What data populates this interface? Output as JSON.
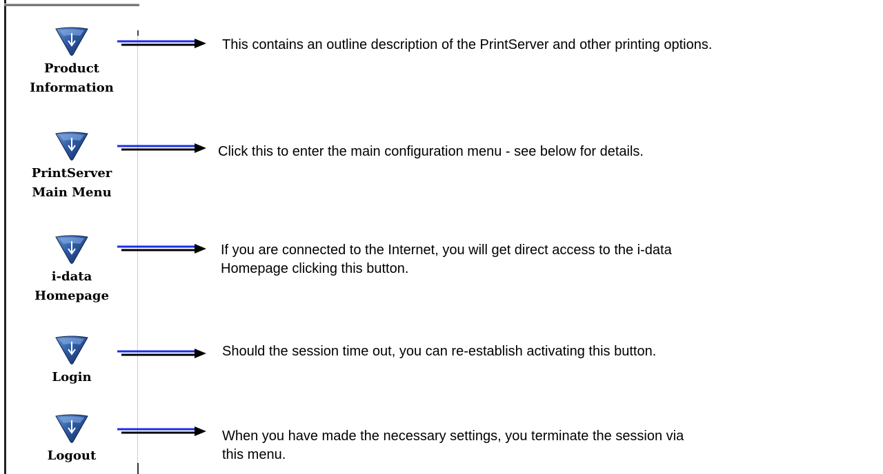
{
  "sidebar": {
    "items": [
      {
        "label": "Product\nInformation",
        "icon": "down-arrow-shield-icon"
      },
      {
        "label": "PrintServer\nMain Menu",
        "icon": "down-arrow-shield-icon"
      },
      {
        "label": "i-data\nHomepage",
        "icon": "down-arrow-shield-icon"
      },
      {
        "label": "Login",
        "icon": "down-arrow-shield-icon"
      },
      {
        "label": "Logout",
        "icon": "down-arrow-shield-icon"
      }
    ]
  },
  "descriptions": [
    "This contains an outline description of the PrintServer and other printing options.",
    "Click this to enter the main configuration menu - see below for details.",
    "If you are connected to the Internet, you will get direct access to the i-data\nHomepage clicking this button.",
    "Should the session time out, you can re-establish activating this button.",
    "When you have made the necessary settings, you terminate the session via\nthis menu."
  ],
  "colors": {
    "icon_dark": "#1c3c74",
    "icon_light": "#5a86c8",
    "arrow_blue": "#1a2ee8",
    "arrow_black": "#000000"
  }
}
